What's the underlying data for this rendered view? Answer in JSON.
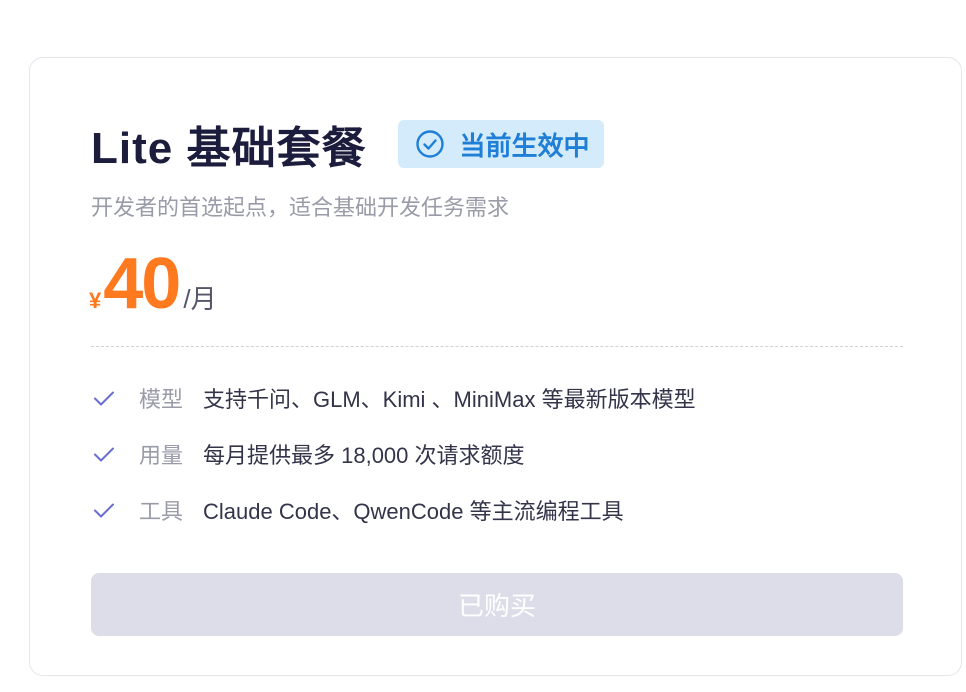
{
  "plan": {
    "title": "Lite 基础套餐",
    "status_badge": "当前生效中",
    "subtitle": "开发者的首选起点，适合基础开发任务需求",
    "currency": "¥",
    "price": "40",
    "period": "/月"
  },
  "features": [
    {
      "label": "模型",
      "value": "支持千问、GLM、Kimi 、MiniMax 等最新版本模型"
    },
    {
      "label": "用量",
      "value": "每月提供最多 18,000 次请求额度"
    },
    {
      "label": "工具",
      "value": "Claude Code、QwenCode 等主流编程工具"
    }
  ],
  "purchase_button": {
    "label": "已购买"
  },
  "colors": {
    "accent_price": "#ff7a1f",
    "badge_bg": "#d4ebfb",
    "badge_text": "#1f7fd6",
    "check": "#6a6fd0",
    "button_disabled": "#dcdde8"
  },
  "icons": {
    "badge": "check-circle-icon",
    "feature": "check-icon"
  }
}
